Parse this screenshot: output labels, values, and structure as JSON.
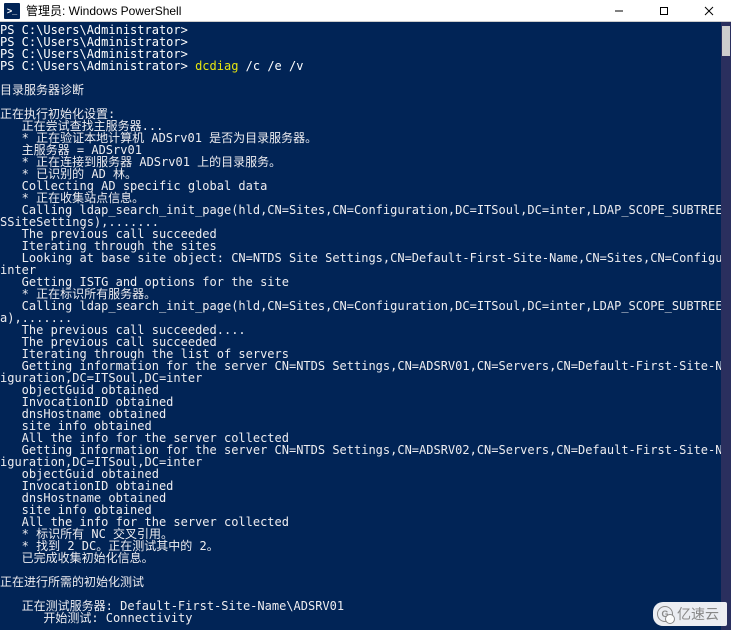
{
  "window": {
    "icon_glyph": ">_",
    "title": "管理员: Windows PowerShell"
  },
  "prompts": {
    "p1": "PS C:\\Users\\Administrator>",
    "p2": "PS C:\\Users\\Administrator>",
    "p3": "PS C:\\Users\\Administrator>",
    "p4_prefix": "PS C:\\Users\\Administrator> ",
    "p4_cmd": "dcdiag",
    "p4_args": " /c /e /v"
  },
  "out": {
    "blank1": "",
    "l01": "目录服务器诊断",
    "blank2": "",
    "l02": "正在执行初始化设置:",
    "l03": "   正在尝试查找主服务器...",
    "l04": "   * 正在验证本地计算机 ADSrv01 是否为目录服务器。",
    "l05": "   主服务器 = ADSrv01",
    "l06": "   * 正在连接到服务器 ADSrv01 上的目录服务。",
    "l07": "   * 已识别的 AD 林。",
    "l08": "   Collecting AD specific global data",
    "l09": "   * 正在收集站点信息。",
    "l10": "   Calling ldap_search_init_page(hld,CN=Sites,CN=Configuration,DC=ITSoul,DC=inter,LDAP_SCOPE_SUBTREE,(objectCategory=ntD",
    "l11": "SSiteSettings),.......",
    "l12": "   The previous call succeeded",
    "l13": "   Iterating through the sites",
    "l14": "   Looking at base site object: CN=NTDS Site Settings,CN=Default-First-Site-Name,CN=Sites,CN=Configuration,DC=ITSoul,DC=",
    "l15": "inter",
    "l16": "   Getting ISTG and options for the site",
    "l17": "   * 正在标识所有服务器。",
    "l18": "   Calling ldap_search_init_page(hld,CN=Sites,CN=Configuration,DC=ITSoul,DC=inter,LDAP_SCOPE_SUBTREE,(objectClass=ntDSDs",
    "l19": "a),.......",
    "l20": "   The previous call succeeded....",
    "l21": "   The previous call succeeded",
    "l22": "   Iterating through the list of servers",
    "l23": "   Getting information for the server CN=NTDS Settings,CN=ADSRV01,CN=Servers,CN=Default-First-Site-Name,CN=Sites,CN=Conf",
    "l24": "iguration,DC=ITSoul,DC=inter",
    "l25": "   objectGuid obtained",
    "l26": "   InvocationID obtained",
    "l27": "   dnsHostname obtained",
    "l28": "   site info obtained",
    "l29": "   All the info for the server collected",
    "l30": "   Getting information for the server CN=NTDS Settings,CN=ADSRV02,CN=Servers,CN=Default-First-Site-Name,CN=Sites,CN=Conf",
    "l31": "iguration,DC=ITSoul,DC=inter",
    "l32": "   objectGuid obtained",
    "l33": "   InvocationID obtained",
    "l34": "   dnsHostname obtained",
    "l35": "   site info obtained",
    "l36": "   All the info for the server collected",
    "l37": "   * 标识所有 NC 交叉引用。",
    "l38": "   * 找到 2 DC。正在测试其中的 2。",
    "l39": "   已完成收集初始化信息。",
    "blank3": "",
    "l40": "正在进行所需的初始化测试",
    "blank4": "",
    "l41": "   正在测试服务器: Default-First-Site-Name\\ADSRV01",
    "l42": "      开始测试: Connectivity"
  },
  "watermark": {
    "text": "亿速云"
  }
}
